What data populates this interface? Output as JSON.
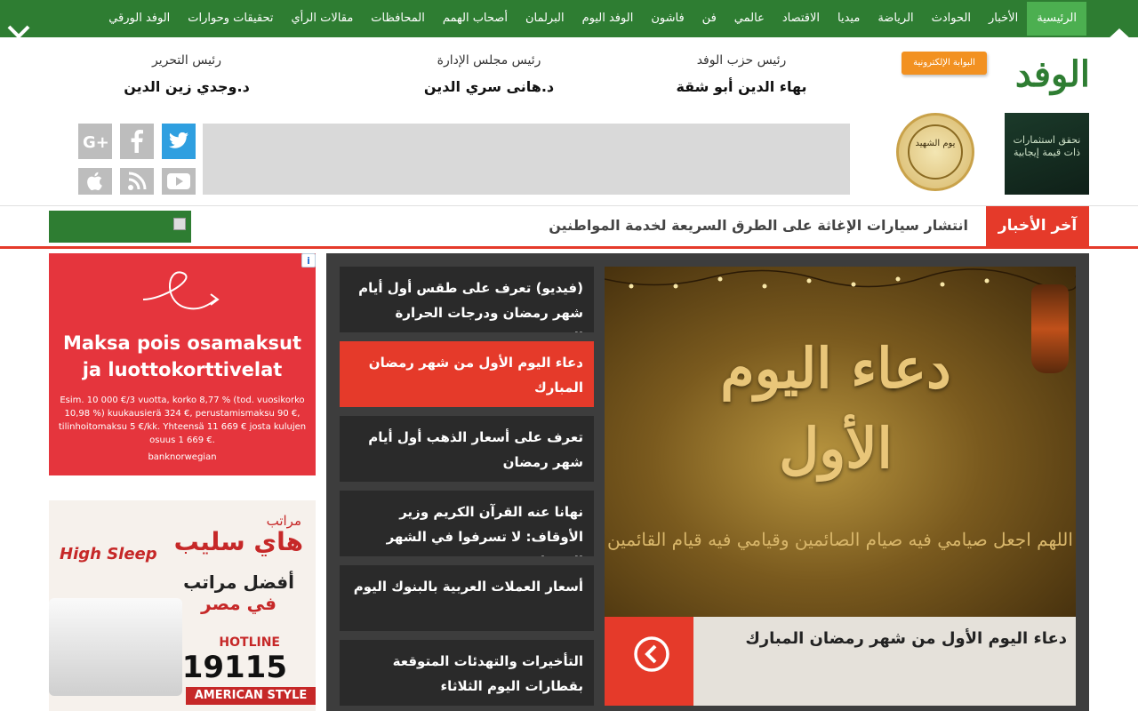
{
  "nav": {
    "items": [
      "الرئيسية",
      "الأخبار",
      "الحوادث",
      "الرياضة",
      "ميديا",
      "الاقتصاد",
      "عالمي",
      "فن",
      "فاشون",
      "الوفد اليوم",
      "البرلمان",
      "أصحاب الهمم",
      "المحافظات",
      "مقالات الرأي",
      "تحقيقات وحوارات",
      "الوفد الورقي"
    ],
    "active": "الرئيسية"
  },
  "logo": {
    "name": "الوفد",
    "tag": "البوابة الإلكترونية"
  },
  "executives": [
    {
      "role": "رئيس حزب الوفد",
      "name": "بهاء الدين أبو شقة"
    },
    {
      "role": "رئيس مجلس الإدارة",
      "name": "د.هانى سري الدين"
    },
    {
      "role": "رئيس التحرير",
      "name": "د.وجدي زين الدين"
    }
  ],
  "ads": {
    "investment": {
      "text": "نحقق استثمارات ذات قيمة إيجابية"
    },
    "seal": {
      "text": "يوم الشهيد"
    },
    "norwegian": {
      "headline": "Maksa pois osamaksut ja luottokorttivelat",
      "fine": "Esim. 10 000 €/3 vuotta, korko 8,77 % (tod. vuosikorko 10,98 %) kuukausierä 324 €, perustamismaksu 90 €, tilinhoitomaksu 5 €/kk. Yhteensä 11 669 € josta kulujen osuus 1 669 €.",
      "bank": "banknorwegian",
      "info": "i"
    },
    "highsleep": {
      "small": "مراتب",
      "title": "هاي سليب",
      "brand": "High Sleep",
      "line1": "أفضل مراتب",
      "line2": "في مصر",
      "hotline": "HOTLINE",
      "number": "19115",
      "style": "AMERICAN STYLE"
    }
  },
  "breaking": {
    "label": "آخر الأخبار",
    "text": "انتشار سيارات الإغاثة على الطرق السريعة لخدمة المواطنين"
  },
  "news_list": [
    "(فيديو) تعرف على طقس أول أيام شهر رمضان ودرجات الحرارة المتوقعة",
    "دعاء اليوم الأول من شهر رمضان المبارك",
    "تعرف على أسعار الذهب أول أيام شهر رمضان",
    "نهانا عنه القرآن الكريم وزير الأوقاف: لا تسرفوا في الشهر الفضيل",
    "أسعار العملات العربية بالبنوك اليوم",
    "التأخيرات والتهدئات المتوقعة بقطارات اليوم الثلاثاء"
  ],
  "hero": {
    "calligraphy": "دعاء اليوم الأول",
    "verse": "اللهم اجعل صيامي فيه صيام الصائمين وقيامي فيه قيام القائمين",
    "caption": "دعاء اليوم الأول من شهر رمضان المبارك"
  },
  "colors": {
    "nav_green": "#2e7d32",
    "accent_red": "#e53a2a",
    "panel_dark": "#3d3d3d"
  }
}
